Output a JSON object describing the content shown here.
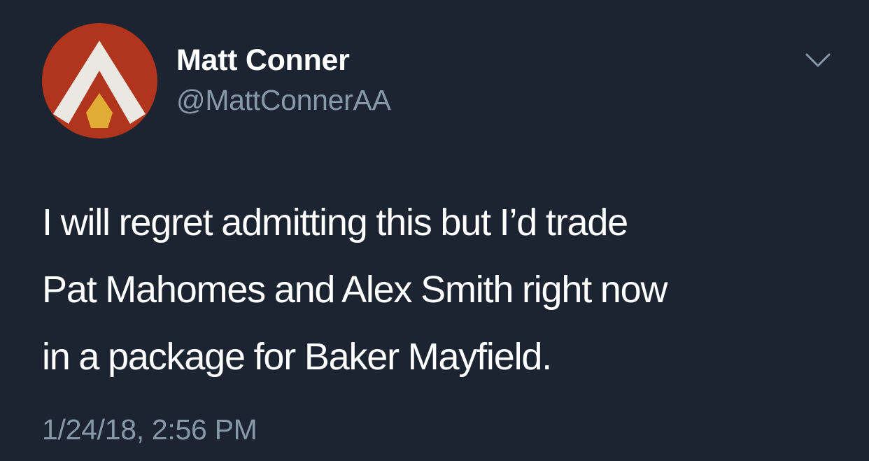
{
  "tweet": {
    "author": {
      "display_name": "Matt Conner",
      "handle": "@MattConnerAA",
      "avatar_icon": "apex-logo-icon",
      "avatar_colors": {
        "background": "#b1341c",
        "arrow": "#ebe7e1",
        "gem": "#e2ad35"
      }
    },
    "menu_icon": "chevron-down-icon",
    "text_lines": [
      "I will regret admitting this but I’d trade",
      "Pat Mahomes and Alex Smith right now",
      "in a package for Baker Mayfield."
    ],
    "timestamp": "1/24/18, 2:56 PM"
  },
  "colors": {
    "background": "#1c2431",
    "primary_text": "#ffffff",
    "secondary_text": "#8899a6"
  }
}
